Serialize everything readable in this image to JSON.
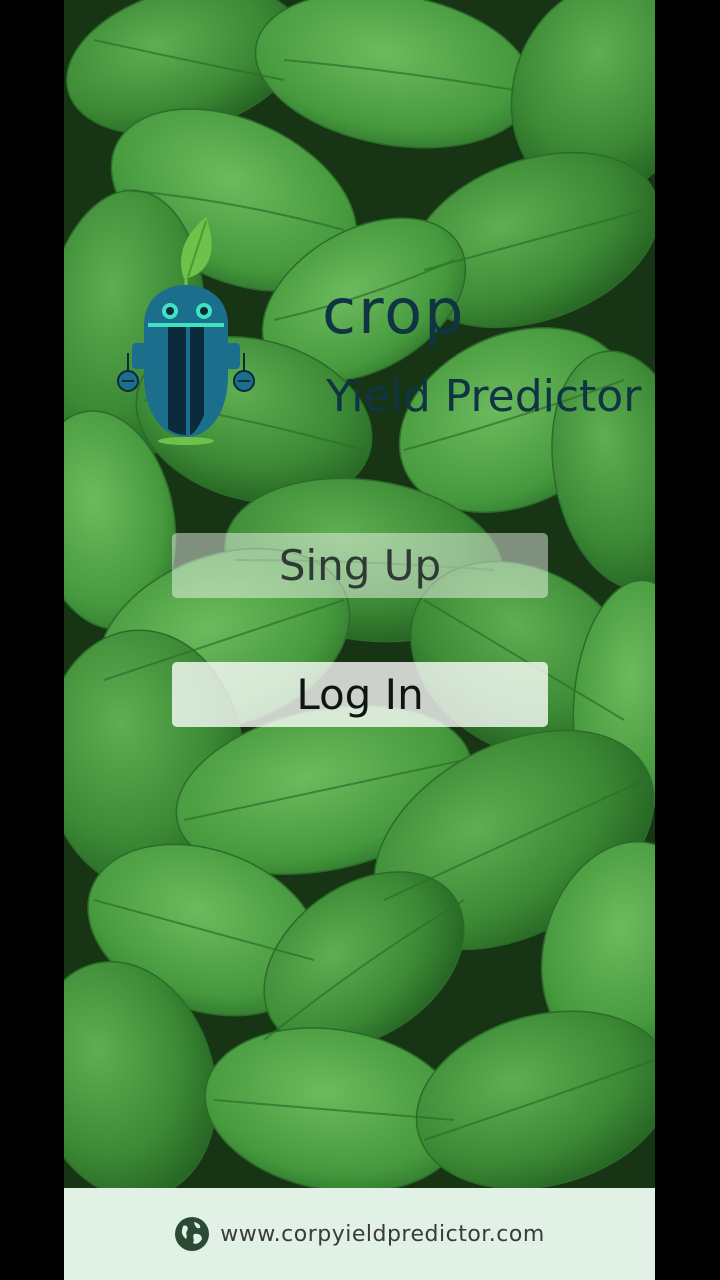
{
  "app": {
    "logo": {
      "word": "crop",
      "subtitle": "Yield Predictor"
    },
    "buttons": {
      "signup_label": "Sing Up",
      "login_label": "Log In"
    },
    "footer": {
      "icon": "globe-icon",
      "url": "www.corpyieldpredictor.com"
    }
  },
  "colors": {
    "logo_text": "#0f3444",
    "leaf_accent": "#6cc24a",
    "footer_bg": "#e1f1e6"
  }
}
